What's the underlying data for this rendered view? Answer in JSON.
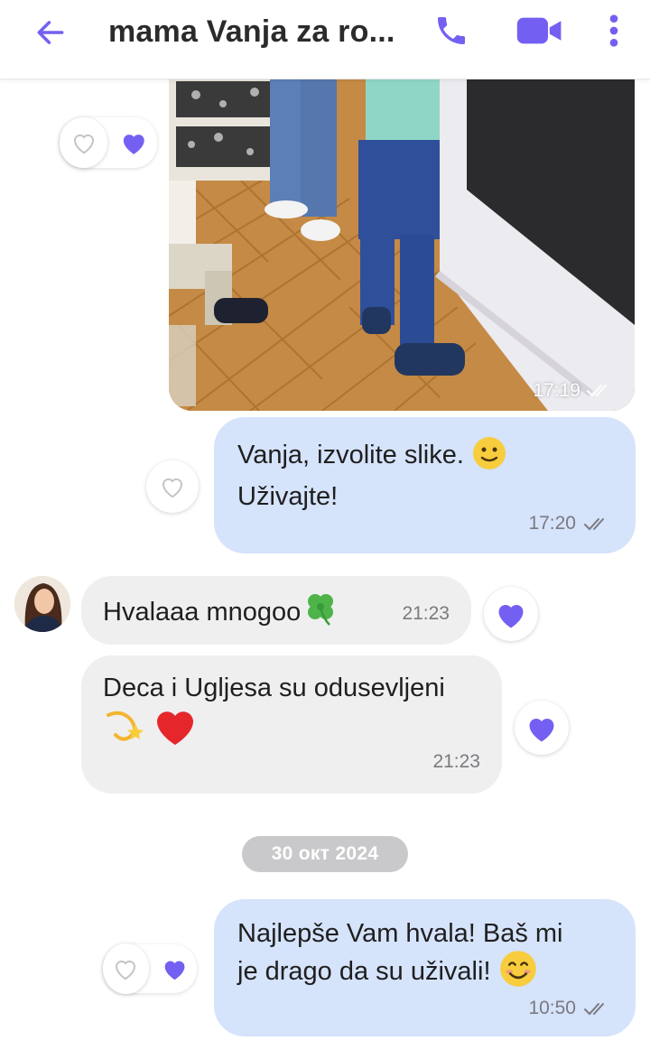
{
  "header": {
    "title": "mama Vanja za ro...",
    "icons": {
      "back": "arrow-left-icon",
      "call": "phone-icon",
      "video": "video-camera-icon",
      "more": "more-vertical-icon"
    },
    "accent": "#7360f2"
  },
  "messages": [
    {
      "id": "photo",
      "type": "image",
      "direction": "out",
      "time": "17:19",
      "status": "delivered-double-check",
      "reactions": {
        "own_liked": false,
        "other_liked": true
      }
    },
    {
      "id": "m1",
      "direction": "out",
      "line1": "Vanja, izvolite slike. ",
      "line2": "Uživajte!",
      "emoji": "slightly-smiling-face",
      "time": "17:20",
      "reactions": {
        "own_liked": false
      }
    },
    {
      "id": "m2",
      "direction": "in",
      "text": "Hvalaaa mnogoo",
      "emoji": "four-leaf-clover",
      "time": "21:23",
      "reactions": {
        "liked": true
      }
    },
    {
      "id": "m3",
      "direction": "in",
      "line1": "Deca i Ugljesa su odusevljeni",
      "emojis": [
        "dizzy",
        "red-heart"
      ],
      "time": "21:23",
      "reactions": {
        "liked": true
      }
    },
    {
      "id": "m4",
      "direction": "out",
      "line1": "Najlepše Vam hvala! Baš mi",
      "line2": "je drago da su uživali! ",
      "emoji": "smiling-face",
      "time": "10:50",
      "reactions": {
        "own_liked": false,
        "other_liked": true
      }
    }
  ],
  "date_separator": "30 окт 2024",
  "colors": {
    "outgoing_bubble": "#d5e3fb",
    "incoming_bubble": "#efefef",
    "heart": "#7360f2",
    "date_chip": "#c9c9cc"
  }
}
